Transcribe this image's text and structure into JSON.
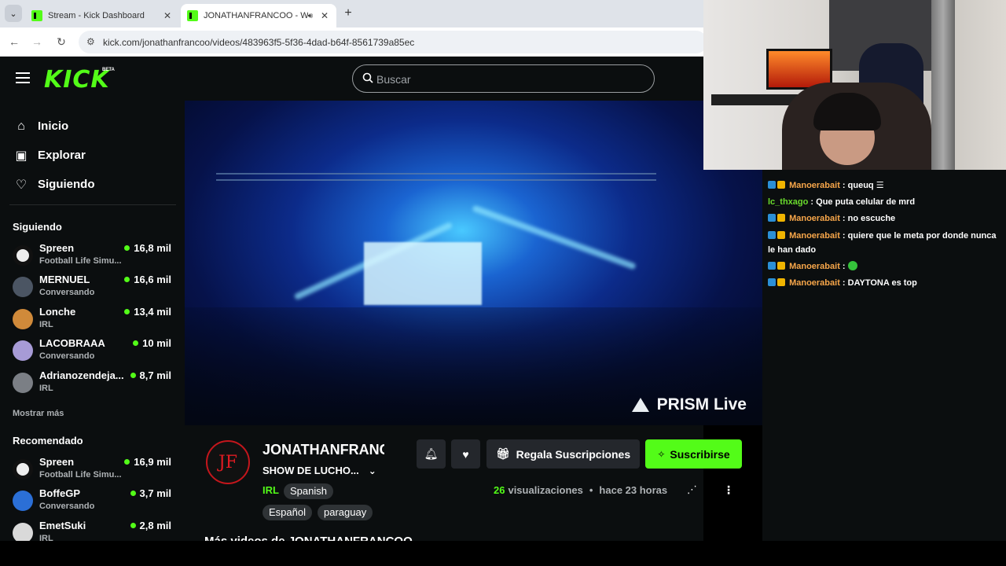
{
  "browser": {
    "tabs": [
      {
        "title": "Stream - Kick Dashboard",
        "active": false
      },
      {
        "title": "JONATHANFRANCOO - Watch",
        "active": true
      }
    ],
    "new_tab": "+",
    "url": "kick.com/jonathanfrancoo/videos/483963f5-5f36-4dad-b64f-8561739a85ec"
  },
  "header": {
    "logo": "KICK",
    "logo_badge": "BETA",
    "search_placeholder": "Buscar"
  },
  "sidebar": {
    "nav": [
      {
        "label": "Inicio",
        "icon": "home-icon"
      },
      {
        "label": "Explorar",
        "icon": "browse-icon"
      },
      {
        "label": "Siguiendo",
        "icon": "heart-icon"
      }
    ],
    "following_title": "Siguiendo",
    "following": [
      {
        "name": "Spreen",
        "category": "Football Life Simu...",
        "viewers": "16,8 mil"
      },
      {
        "name": "MERNUEL",
        "category": "Conversando",
        "viewers": "16,6 mil"
      },
      {
        "name": "Lonche",
        "category": "IRL",
        "viewers": "13,4 mil"
      },
      {
        "name": "LACOBRAAA",
        "category": "Conversando",
        "viewers": "10 mil"
      },
      {
        "name": "Adrianozendeja...",
        "category": "IRL",
        "viewers": "8,7 mil"
      }
    ],
    "show_more": "Mostrar más",
    "recommended_title": "Recomendado",
    "recommended": [
      {
        "name": "Spreen",
        "category": "Football Life Simu...",
        "viewers": "16,9 mil"
      },
      {
        "name": "BoffeGP",
        "category": "Conversando",
        "viewers": "3,7 mil"
      },
      {
        "name": "EmetSuki",
        "category": "IRL",
        "viewers": "2,8 mil"
      }
    ]
  },
  "video": {
    "watermark": "PRISM Live"
  },
  "channel": {
    "avatar_text": "JF",
    "name": "JONATHANFRANCOO",
    "video_title": "SHOW DE LUCHO...",
    "category": "IRL",
    "tags": [
      "Spanish",
      "Español",
      "paraguay"
    ],
    "gift_label": "Regala Suscripciones",
    "subscribe_label": "Suscribirse",
    "views_count": "26",
    "views_label": "visualizaciones",
    "separator": "•",
    "time_ago": "hace 23 horas",
    "more_videos": "Más videos de JONATHANFRANCOO"
  },
  "chat": {
    "messages": [
      {
        "user": "Manoerabait",
        "text": ": queuq"
      },
      {
        "user": "lc_thxago",
        "text": ": Que puta celular de mrd"
      },
      {
        "user": "Manoerabait",
        "text": ": no escuche"
      },
      {
        "user": "Manoerabait",
        "text": ": quiere que le meta por donde nunca le han dado"
      },
      {
        "user": "Manoerabait",
        "text": ":"
      },
      {
        "user": "Manoerabait",
        "text": ": DAYTONA es top"
      }
    ]
  },
  "colors": {
    "accent": "#53fc18",
    "background": "#0b0e0f",
    "chat_user": "#f7a64a"
  }
}
